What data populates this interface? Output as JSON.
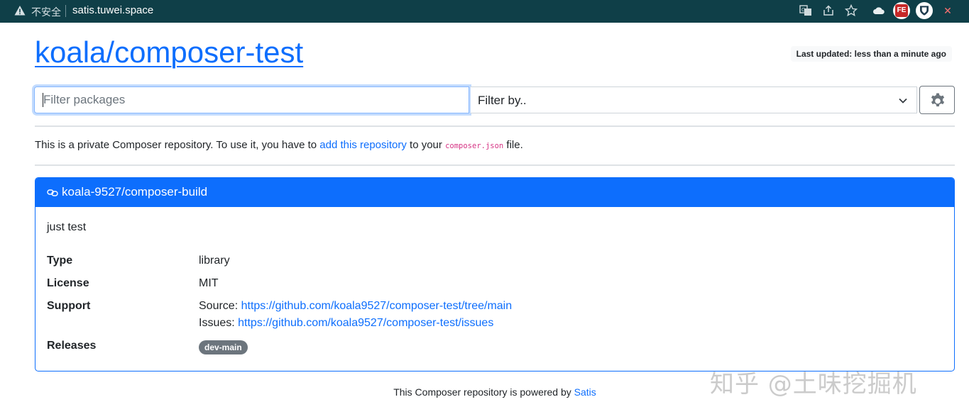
{
  "browser": {
    "insecure_label": "不安全",
    "url": "satis.tuwei.space",
    "ext_fe_label": "FE"
  },
  "header": {
    "title": "koala/composer-test",
    "last_updated": "Last updated: less than a minute ago"
  },
  "filter": {
    "placeholder": "Filter packages",
    "select_label": "Filter by.."
  },
  "intro": {
    "prefix": "This is a private Composer repository. To use it, you have to ",
    "link": "add this repository",
    "middle": " to your ",
    "code": "composer.json",
    "suffix": " file."
  },
  "package": {
    "name": "koala-9527/composer-build",
    "description": "just test",
    "type_label": "Type",
    "type_value": "library",
    "license_label": "License",
    "license_value": "MIT",
    "support_label": "Support",
    "source_prefix": "Source: ",
    "source_url": "https://github.com/koala9527/composer-test/tree/main",
    "issues_prefix": "Issues: ",
    "issues_url": "https://github.com/koala9527/composer-test/issues",
    "releases_label": "Releases",
    "release_badge": "dev-main"
  },
  "footer": {
    "prefix": "This Composer repository is powered by ",
    "link": "Satis"
  },
  "watermark": "知乎 @土味挖掘机",
  "colors": {
    "primary": "#0d6efd",
    "browser_bar": "#0f3f48",
    "badge": "#6c757d"
  }
}
